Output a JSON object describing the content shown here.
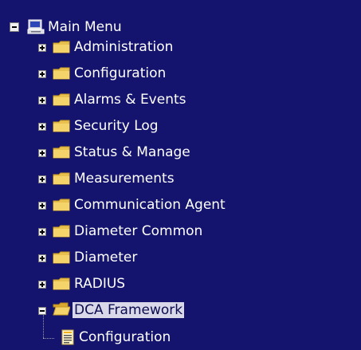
{
  "tree": {
    "root": {
      "label": "Main Menu",
      "icon": "computer-icon",
      "state": "expanded"
    },
    "items": [
      {
        "label": "Administration",
        "icon": "folder-icon",
        "state": "collapsed"
      },
      {
        "label": "Configuration",
        "icon": "folder-icon",
        "state": "collapsed"
      },
      {
        "label": "Alarms & Events",
        "icon": "folder-icon",
        "state": "collapsed"
      },
      {
        "label": "Security Log",
        "icon": "folder-icon",
        "state": "collapsed"
      },
      {
        "label": "Status & Manage",
        "icon": "folder-icon",
        "state": "collapsed"
      },
      {
        "label": "Measurements",
        "icon": "folder-icon",
        "state": "collapsed"
      },
      {
        "label": "Communication Agent",
        "icon": "folder-icon",
        "state": "collapsed"
      },
      {
        "label": "Diameter Common",
        "icon": "folder-icon",
        "state": "collapsed"
      },
      {
        "label": "Diameter",
        "icon": "folder-icon",
        "state": "collapsed"
      },
      {
        "label": "RADIUS",
        "icon": "folder-icon",
        "state": "collapsed"
      },
      {
        "label": "DCA Framework",
        "icon": "open-folder-icon",
        "state": "expanded",
        "selected": true
      }
    ],
    "child": {
      "label": "Configuration",
      "icon": "document-icon"
    }
  },
  "colors": {
    "background": "#14146e",
    "text": "#ffffff",
    "folder": "#e8c050",
    "selection": "#d8d8e8"
  }
}
